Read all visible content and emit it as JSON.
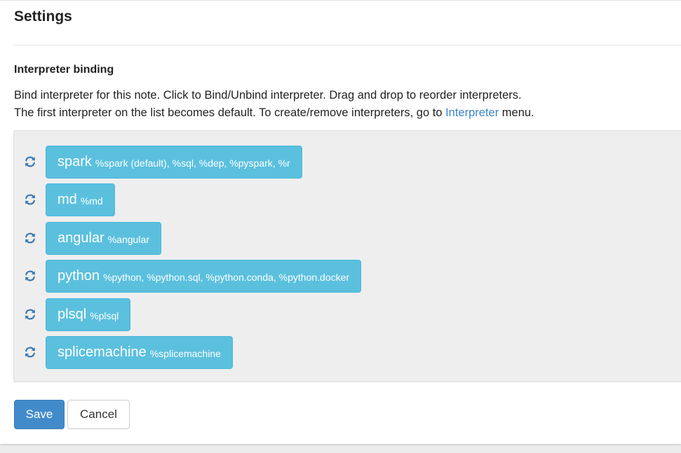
{
  "dialog": {
    "title": "Settings"
  },
  "binding": {
    "heading": "Interpreter binding",
    "description_line1": "Bind interpreter for this note. Click to Bind/Unbind interpreter. Drag and drop to reorder interpreters.",
    "description_line2_prefix": "The first interpreter on the list becomes default. To create/remove interpreters, go to ",
    "description_link": "Interpreter",
    "description_line2_suffix": " menu.",
    "link_color": "#3a86c8",
    "button_color": "#5bc0de",
    "refresh_icon": "refresh-icon",
    "interpreters": [
      {
        "name": "spark",
        "aliases": "%spark (default), %sql, %dep, %pyspark, %r"
      },
      {
        "name": "md",
        "aliases": "%md"
      },
      {
        "name": "angular",
        "aliases": "%angular"
      },
      {
        "name": "python",
        "aliases": "%python, %python.sql, %python.conda, %python.docker"
      },
      {
        "name": "plsql",
        "aliases": "%plsql"
      },
      {
        "name": "splicemachine",
        "aliases": "%splicemachine"
      }
    ]
  },
  "actions": {
    "save_label": "Save",
    "cancel_label": "Cancel",
    "save_color": "#428bca"
  }
}
